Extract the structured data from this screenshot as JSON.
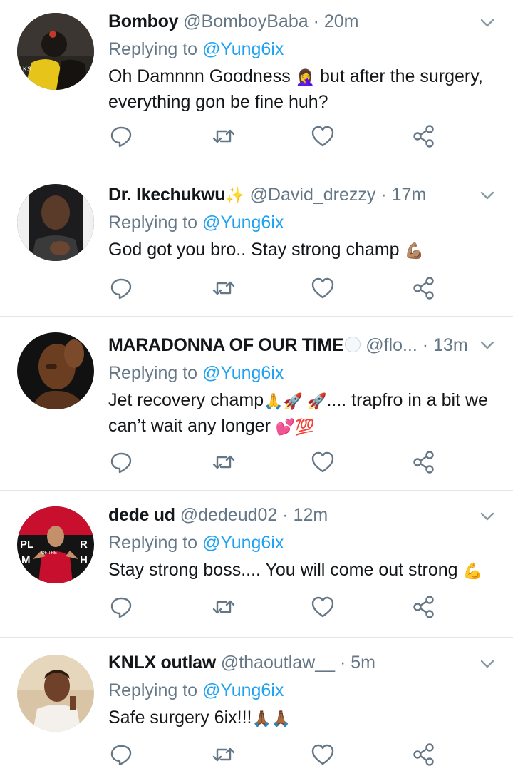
{
  "tweets": [
    {
      "name": "Bomboy",
      "handle": "@BomboyBaba",
      "time": "20m",
      "replying_prefix": "Replying to",
      "replying_to": "@Yung6ix",
      "text_part1": "Oh Damnnn Goodness ",
      "emoji1": "🤦‍♀️",
      "text_part2": " but after the surgery, everything gon be fine huh?"
    },
    {
      "name": "Dr. Ikechukwu",
      "name_emoji": "✨",
      "handle": "@David_drezzy",
      "time": "17m",
      "replying_prefix": "Replying to",
      "replying_to": "@Yung6ix",
      "text_part1": "God got you bro.. Stay strong champ ",
      "emoji1": "💪🏽"
    },
    {
      "name": "MARADONNA OF OUR TIME",
      "handle": "@flo...",
      "time": "13m",
      "replying_prefix": "Replying to",
      "replying_to": "@Yung6ix",
      "text_part1": "Jet recovery champ",
      "emoji1": "🙏🚀 🚀",
      "text_part2": ".... trapfro in a bit we can’t wait any longer ",
      "emoji2": "💕💯"
    },
    {
      "name": "dede ud",
      "handle": "@dedeud02",
      "time": "12m",
      "replying_prefix": "Replying to",
      "replying_to": "@Yung6ix",
      "text_part1": "Stay strong boss.... You will come out strong ",
      "emoji1": "💪",
      "avatar_text_left": "PL",
      "avatar_text_right": "R",
      "avatar_text_mid": "OF THE",
      "avatar_text_bottom_left": "M",
      "avatar_text_bottom_right": "H"
    },
    {
      "name": "KNLX outlaw",
      "handle": "@thaoutlaw__",
      "time": "5m",
      "replying_prefix": "Replying to",
      "replying_to": "@Yung6ix",
      "text_part1": "Safe surgery 6ix!!!",
      "emoji1": "🙏🏾🙏🏾"
    }
  ],
  "separator": "·",
  "icons": {
    "reply": "reply-icon",
    "retweet": "retweet-icon",
    "like": "heart-icon",
    "share": "share-icon",
    "more": "chevron-down-icon"
  },
  "colors": {
    "link": "#1da1f2",
    "secondary": "#657786",
    "divider": "#e1e8ed"
  }
}
